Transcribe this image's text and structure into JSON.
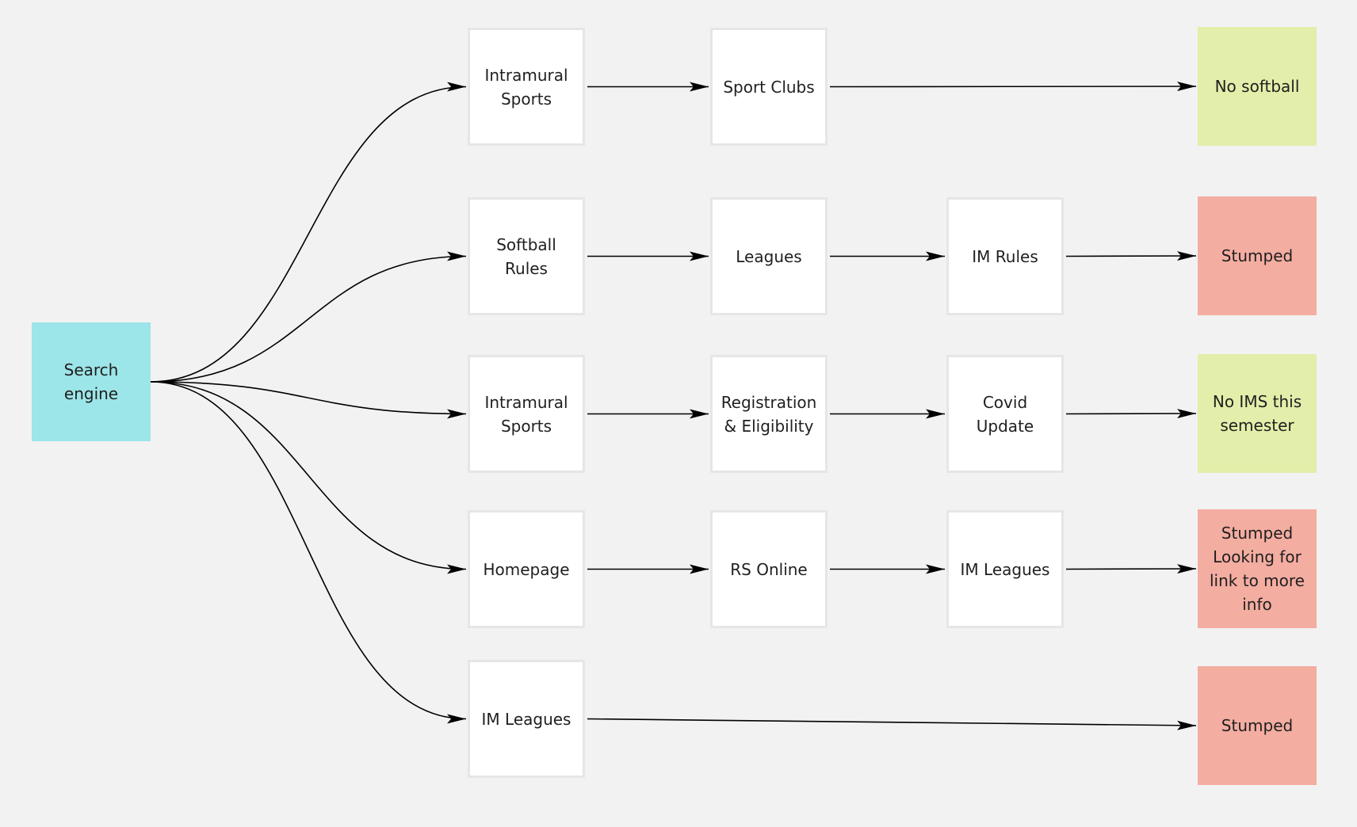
{
  "diagram": {
    "type": "flowchart",
    "colors": {
      "background": "#f2f2f2",
      "start": "#9ce5e8",
      "page": "#ffffff",
      "success": "#e3eeaa",
      "fail": "#f4ada1",
      "edge": "#000000"
    },
    "start": {
      "id": "search",
      "label": "Search\nengine",
      "kind": "start"
    },
    "paths": [
      {
        "steps": [
          {
            "id": "p1s1",
            "label": "Intramural\nSports",
            "kind": "page"
          },
          {
            "id": "p1s2",
            "label": "Sport Clubs",
            "kind": "page"
          }
        ],
        "outcome": {
          "id": "p1out",
          "label": "No softball",
          "kind": "success"
        }
      },
      {
        "steps": [
          {
            "id": "p2s1",
            "label": "Softball Rules",
            "kind": "page"
          },
          {
            "id": "p2s2",
            "label": "Leagues",
            "kind": "page"
          },
          {
            "id": "p2s3",
            "label": "IM Rules",
            "kind": "page"
          }
        ],
        "outcome": {
          "id": "p2out",
          "label": "Stumped",
          "kind": "fail"
        }
      },
      {
        "steps": [
          {
            "id": "p3s1",
            "label": "Intramural\nSports",
            "kind": "page"
          },
          {
            "id": "p3s2",
            "label": "Registration\n& Eligibility",
            "kind": "page"
          },
          {
            "id": "p3s3",
            "label": "Covid Update",
            "kind": "page"
          }
        ],
        "outcome": {
          "id": "p3out",
          "label": "No IMS this\nsemester",
          "kind": "success"
        }
      },
      {
        "steps": [
          {
            "id": "p4s1",
            "label": "Homepage",
            "kind": "page"
          },
          {
            "id": "p4s2",
            "label": "RS Online",
            "kind": "page"
          },
          {
            "id": "p4s3",
            "label": "IM Leagues",
            "kind": "page"
          }
        ],
        "outcome": {
          "id": "p4out",
          "label": "Stumped\nLooking for\nlink to more\ninfo",
          "kind": "fail"
        }
      },
      {
        "steps": [
          {
            "id": "p5s1",
            "label": "IM Leagues",
            "kind": "page"
          }
        ],
        "outcome": {
          "id": "p5out",
          "label": "Stumped",
          "kind": "fail"
        }
      }
    ]
  }
}
